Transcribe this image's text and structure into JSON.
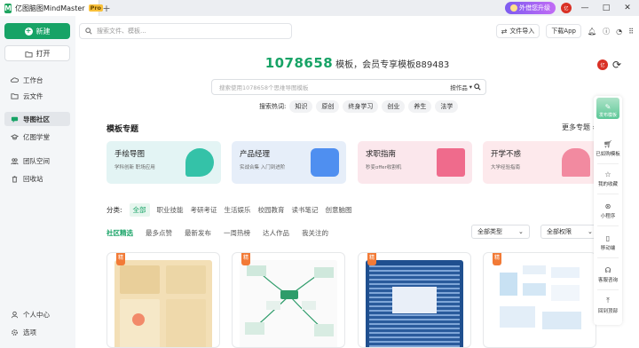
{
  "titlebar": {
    "app_title": "亿图脑图MindMaster",
    "pro_badge": "Pro",
    "new_tab_icon": "+",
    "upgrade_label": "外借您升级",
    "user_initials": "亿",
    "window_buttons": [
      "—",
      "□",
      "✕"
    ]
  },
  "sidebar": {
    "new_label": "新建",
    "open_label": "打开",
    "items": [
      {
        "label": "工作台",
        "icon": "cloud-icon"
      },
      {
        "label": "云文件",
        "icon": "folder-icon"
      },
      {
        "label": "导图社区",
        "icon": "chat-icon",
        "active": true
      },
      {
        "label": "亿图学堂",
        "icon": "graduation-cap-icon"
      },
      {
        "label": "团队空间",
        "icon": "team-icon"
      },
      {
        "label": "回收站",
        "icon": "trash-icon"
      }
    ],
    "bottom_items": [
      {
        "label": "个人中心",
        "icon": "user-icon"
      },
      {
        "label": "选项",
        "icon": "gear-icon"
      }
    ]
  },
  "top": {
    "search_placeholder": "搜索文件、模板...",
    "import_label": "文件导入",
    "download_label": "下载App"
  },
  "hero": {
    "count": "1078658",
    "text": "模板，会员专享模板889483",
    "search_placeholder": "搜索使用1078658个思维导图模板",
    "sort_label": "按作品",
    "hot_label": "搜索热词:",
    "hot_words": [
      "知识",
      "原创",
      "终身学习",
      "创业",
      "养生",
      "法学"
    ]
  },
  "topics": {
    "title": "模板专题",
    "more_label": "更多专题",
    "cards": [
      {
        "title": "手绘导图",
        "subtitle": "学科创新 职场应用",
        "bg": "#e3f4f4",
        "art": "#34c2a8"
      },
      {
        "title": "产品经理",
        "subtitle": "实战合集 入门到进阶",
        "bg": "#e6eef9",
        "art": "#4f8ff0"
      },
      {
        "title": "求职指南",
        "subtitle": "秒变offer收割机",
        "bg": "#fbe7ec",
        "art": "#ef6b8c"
      },
      {
        "title": "开学不惑",
        "subtitle": "大学经验指南",
        "bg": "#fde9ec",
        "art": "#f28aa0"
      }
    ]
  },
  "filters": {
    "label": "分类:",
    "options": [
      "全部",
      "职业技能",
      "考研考证",
      "生活娱乐",
      "校园教育",
      "读书笔记",
      "创意脑图"
    ]
  },
  "tabs": [
    "社区精选",
    "最多点赞",
    "最新发布",
    "一周热榜",
    "达人作品",
    "我关注的"
  ],
  "selects": {
    "type": "全部类型",
    "perm": "全部权限"
  },
  "thumb_badge": "精",
  "right_bar": {
    "top_label": "发布模板",
    "items": [
      {
        "label": "已如购模板",
        "icon": "cart-icon"
      },
      {
        "label": "我的收藏",
        "icon": "star-icon"
      },
      {
        "label": "小程序",
        "icon": "miniprogram-icon"
      },
      {
        "label": "移动端",
        "icon": "mobile-icon"
      },
      {
        "label": "客服咨询",
        "icon": "headset-icon"
      },
      {
        "label": "回到顶部",
        "icon": "back-to-top-icon"
      }
    ]
  },
  "colors": {
    "accent": "#17a366",
    "active_filter_bg": "#e6f6ee"
  }
}
